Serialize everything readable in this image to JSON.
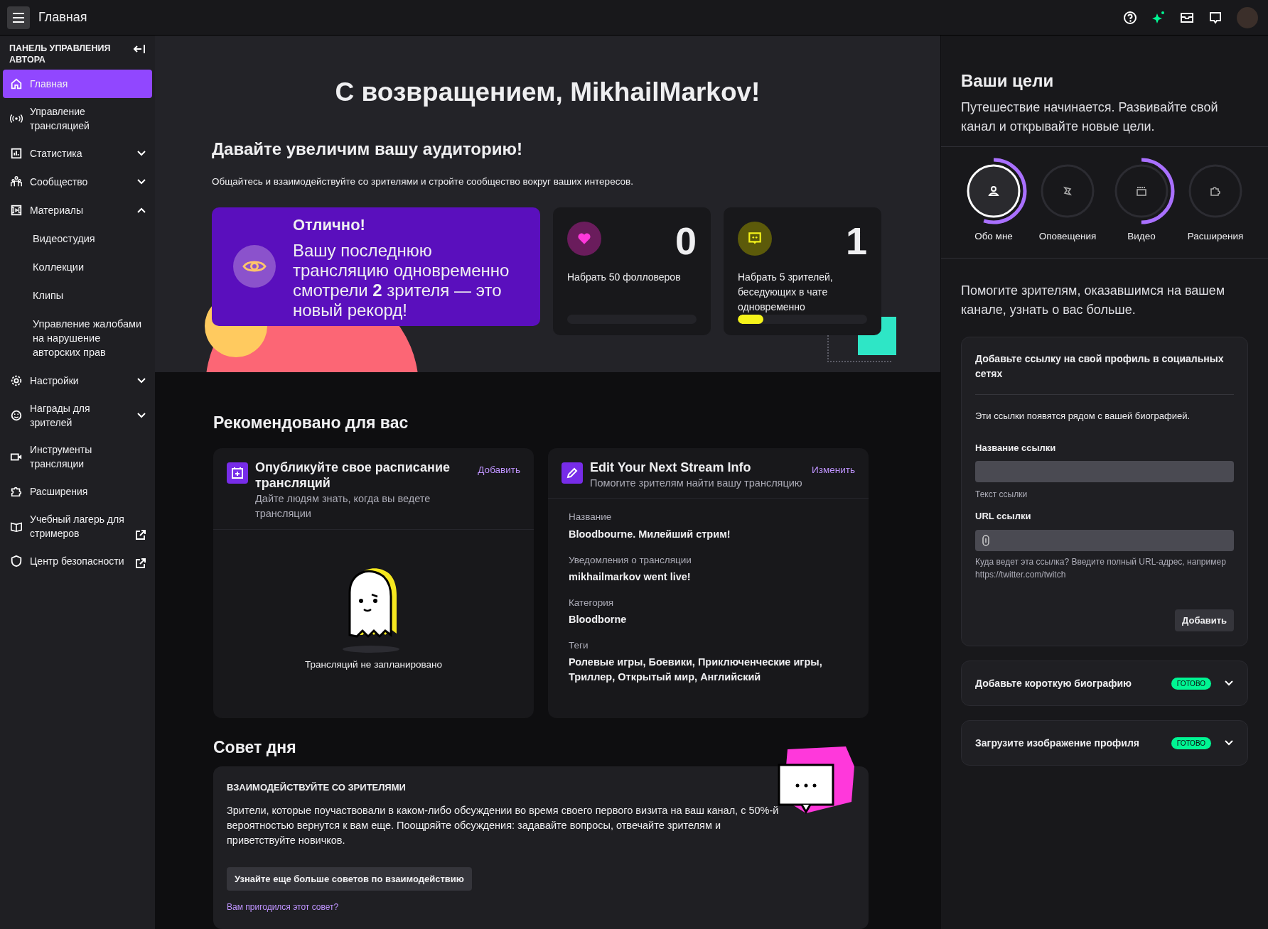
{
  "topbar": {
    "title": "Главная"
  },
  "sidebar": {
    "header": "ПАНЕЛЬ УПРАВЛЕНИЯ АВТОРА",
    "items": [
      {
        "label": "Главная",
        "selected": true
      },
      {
        "label": "Управление трансляцией",
        "selected": false
      },
      {
        "label": "Статистика",
        "selected": false,
        "expanded": false
      },
      {
        "label": "Сообщество",
        "selected": false,
        "expanded": false
      },
      {
        "label": "Материалы",
        "selected": false,
        "expanded": true,
        "children": [
          {
            "label": "Видеостудия"
          },
          {
            "label": "Коллекции"
          },
          {
            "label": "Клипы"
          },
          {
            "label": "Управление жалобами на нарушение авторских прав"
          }
        ]
      },
      {
        "label": "Настройки",
        "selected": false,
        "expanded": false
      },
      {
        "label": "Награды для зрителей",
        "selected": false,
        "expanded": false
      },
      {
        "label": "Инструменты трансляции",
        "selected": false
      },
      {
        "label": "Расширения",
        "selected": false
      },
      {
        "label": "Учебный лагерь для стримеров",
        "selected": false,
        "external": true
      },
      {
        "label": "Центр безопасности",
        "selected": false,
        "external": true
      }
    ]
  },
  "hero": {
    "title": "С возвращением, MikhailMarkov!",
    "subtitle": "Давайте увеличим вашу аудиторию!",
    "description": "Общайтесь и взаимодействуйте со зрителями и стройте сообщество вокруг ваших интересов.",
    "record": {
      "heading": "Отлично!",
      "text": "Вашу последнюю трансляцию одновременно смотрели **2** зрителя — это новый рекорд!"
    },
    "stats": [
      {
        "value": "0",
        "label": "Набрать 50 фолловеров",
        "level": 0
      },
      {
        "value": "1",
        "label": "Набрать 5 зрителей, беседующих в чате одновременно",
        "level": 0.2
      }
    ]
  },
  "recommended": {
    "title": "Рекомендовано для вас",
    "cards": [
      {
        "kind": "schedule",
        "title": "Опубликуйте свое расписание трансляций",
        "subtitle": "Дайте людям знать, когда вы ведете трансляции",
        "action": "Добавить",
        "empty": "Трансляций не запланировано"
      },
      {
        "kind": "info",
        "title": "Edit Your Next Stream Info",
        "subtitle": "Помогите зрителям найти вашу трансляцию",
        "action": "Изменить",
        "fields": [
          {
            "label": "Название",
            "value": "Bloodbourne. Милейший стрим!"
          },
          {
            "label": "Уведомления о трансляции",
            "value": "mikhailmarkov went live!"
          },
          {
            "label": "Категория",
            "value": "Bloodborne"
          },
          {
            "label": "Теги",
            "value": "Ролевые игры, Боевики, Приключенческие игры, Триллер, Открытый мир, Английский"
          }
        ]
      }
    ]
  },
  "tip": {
    "title": "Совет дня",
    "heading": "ВЗАИМОДЕЙСТВУЙТЕ СО ЗРИТЕЛЯМИ",
    "text": "Зрители, которые поучаствовали в каком-либо обсуждении во время своего первого визита на ваш канал, с 50%-й вероятностью вернутся к вам еще. Поощряйте обсуждения: задавайте вопросы, отвечайте зрителям и приветствуйте новичков.",
    "button": "Узнайте еще больше советов по взаимодействию",
    "link": "Вам пригодился этот совет?"
  },
  "goals": {
    "title": "Ваши цели",
    "description": "Путешествие начинается. Развивайте свой канал и открывайте новые цели.",
    "tabs": [
      {
        "label": "Обо мне",
        "selected": true,
        "level": 0.55
      },
      {
        "label": "Оповещения",
        "selected": false
      },
      {
        "label": "Видео",
        "selected": false,
        "level": 0.5
      },
      {
        "label": "Расширения",
        "selected": false
      }
    ],
    "prompt": "Помогите зрителям, оказавшимся на вашем канале, узнать о вас больше.",
    "social": {
      "title": "Добавьте ссылку на свой профиль в социальных сетях",
      "note": "Эти ссылки появятся рядом с вашей биографией.",
      "name_label": "Название ссылки",
      "name_hint": "Текст ссылки",
      "url_label": "URL ссылки",
      "url_hint": "Куда ведет эта ссылка? Введите полный URL-адрес, например https://twitter.com/twitch",
      "button": "Добавить"
    },
    "tasks": [
      {
        "label": "Добавьте короткую биографию",
        "done": true,
        "badge": "ГОТОВО",
        "expanded": false
      },
      {
        "label": "Загрузите изображение профиля",
        "done": true,
        "badge": "ГОТОВО",
        "expanded": false
      }
    ]
  }
}
